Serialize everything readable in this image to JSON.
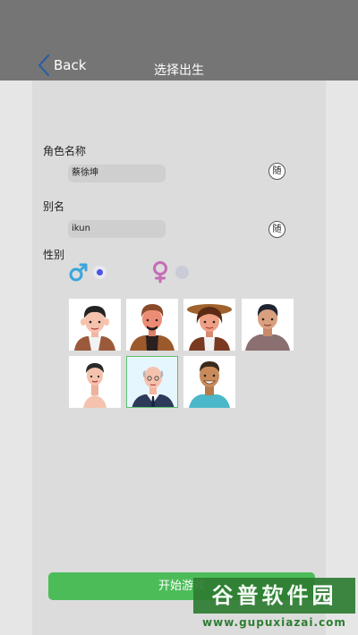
{
  "header": {
    "back_label": "Back",
    "title": "选择出生"
  },
  "form": {
    "name_label": "角色名称",
    "name_value": "蔡徐坤",
    "alias_label": "别名",
    "alias_value": "ikun",
    "random_button_label": "随",
    "gender_label": "性别",
    "gender_options": [
      {
        "icon": "male-icon",
        "selected": true,
        "color": "#3aa6dd"
      },
      {
        "icon": "female-icon",
        "selected": false,
        "color": "#c46db6"
      }
    ]
  },
  "avatars": [
    {
      "name": "avatar-1",
      "selected": false
    },
    {
      "name": "avatar-2",
      "selected": false
    },
    {
      "name": "avatar-3",
      "selected": false
    },
    {
      "name": "avatar-4",
      "selected": false
    },
    {
      "name": "avatar-5",
      "selected": false
    },
    {
      "name": "avatar-6",
      "selected": true
    },
    {
      "name": "avatar-7",
      "selected": false
    }
  ],
  "start_button_label": "开始游戏",
  "watermark": {
    "text": "谷普软件园",
    "url": "www.gupuxiazai.com"
  },
  "colors": {
    "accent_green": "#4cbc58",
    "header_gray": "#757575",
    "radio_selected": "#4a55e0"
  }
}
